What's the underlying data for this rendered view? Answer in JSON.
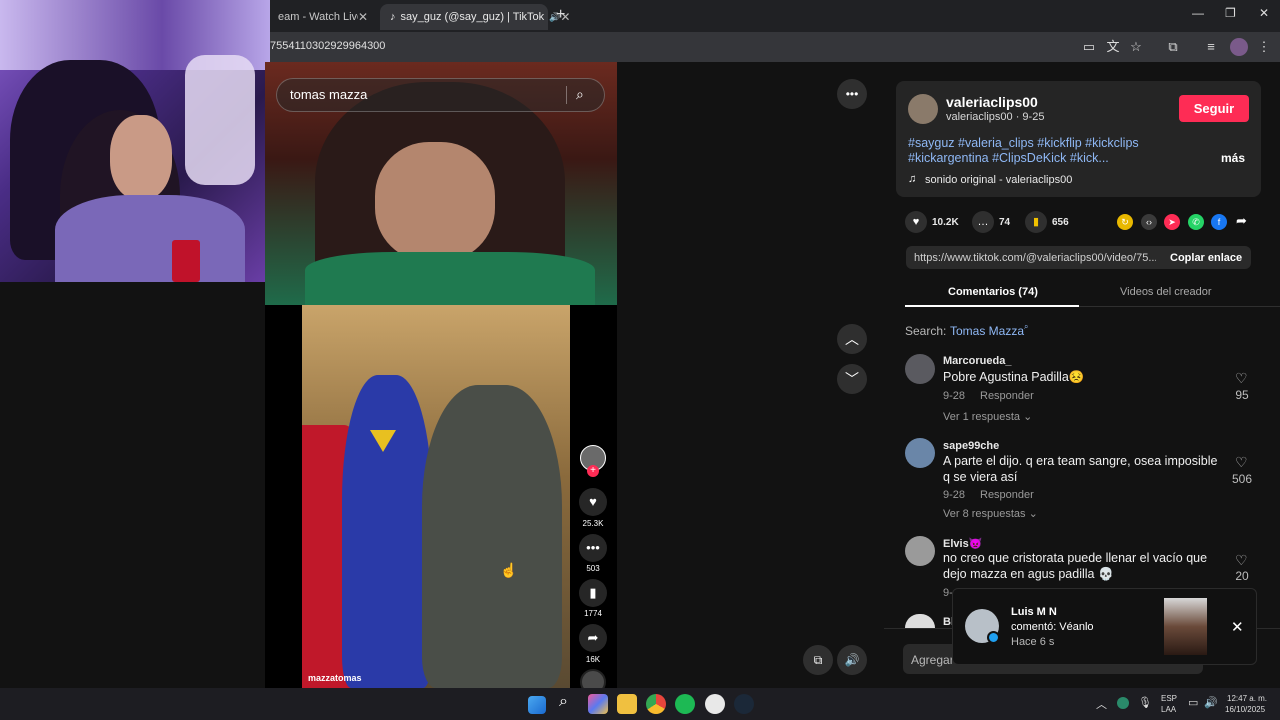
{
  "browser": {
    "tabs": [
      {
        "label": "eam - Watch Live or",
        "close": "✕"
      },
      {
        "label": "say_guz (@say_guz) | TikTok",
        "close": "✕"
      }
    ],
    "new_tab": "+",
    "url": "7554110302929964300",
    "window_controls": {
      "minimize": "—",
      "restore": "❐",
      "close": "✕"
    }
  },
  "video": {
    "search_value": "tomas mazza",
    "watermark": "mazzatomas",
    "actions": [
      {
        "icon": "heart-icon",
        "count": "25.3K"
      },
      {
        "icon": "comment-icon",
        "count": "503"
      },
      {
        "icon": "bookmark-icon",
        "count": "1774"
      },
      {
        "icon": "share-icon",
        "count": "16K"
      }
    ]
  },
  "post": {
    "username": "valeriaclips00",
    "handle_date": "valeriaclips00 · 9-25",
    "follow_label": "Seguir",
    "hashtags_line1": "#sayguz #valeria_clips #kickflip #kickclips",
    "hashtags_line2": "#kickargentina #ClipsDeKick #kick...",
    "more_label": "más",
    "sound": "sonido original - valeriaclips00",
    "likes": "10.2K",
    "comments": "74",
    "saves": "656",
    "link": "https://www.tiktok.com/@valeriaclips00/video/75...",
    "copy_link_label": "Coplar enlace"
  },
  "tabs": {
    "comments": "Comentarios (74)",
    "creator_videos": "Videos del creador"
  },
  "search_hint": {
    "prefix": "Search:",
    "term": "Tomas Mazza"
  },
  "comments": [
    {
      "name": "Marcorueda_",
      "text": "Pobre Agustina Padilla😣",
      "date": "9-28",
      "reply": "Responder",
      "likes": "95",
      "replies": "Ver 1 respuesta"
    },
    {
      "name": "sape99che",
      "text": "A parte el dijo. q era team sangre, osea imposible q se viera así",
      "date": "9-28",
      "reply": "Responder",
      "likes": "506",
      "replies": "Ver 8 respuestas"
    },
    {
      "name": "Elvis👿",
      "text": "no creo que cristorata puede llenar el vacío que dejo mazza en agus padilla 💀",
      "date": "9-",
      "reply": "",
      "likes": "20",
      "replies": ""
    },
    {
      "name": "Bl",
      "text": "",
      "date": "",
      "reply": "",
      "likes": "",
      "replies": ""
    }
  ],
  "add_comment_placeholder": "Agregar",
  "notification": {
    "name": "Luis M N",
    "action": "comentó: Véanlo",
    "time": "Hace 6 s",
    "close": "✕"
  },
  "taskbar": {
    "lang_line1": "ESP",
    "lang_line2": "LAA",
    "time": "12:47 a. m.",
    "date": "16/10/2025"
  }
}
